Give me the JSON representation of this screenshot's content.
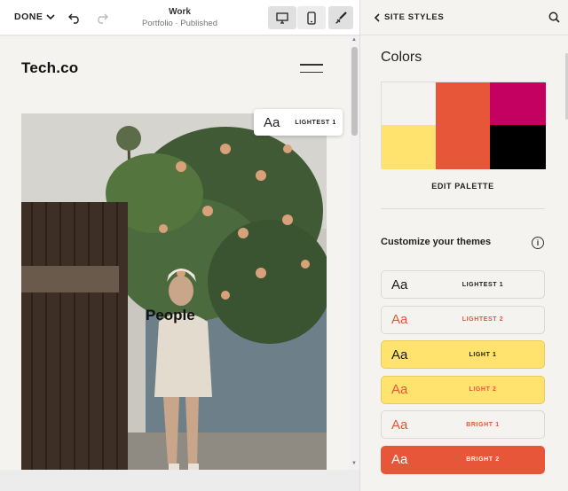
{
  "topbar": {
    "done_label": "DONE",
    "page_title": "Work",
    "page_subtitle": "Portfolio · Published"
  },
  "preview": {
    "logo": "Tech.co",
    "hero_text": "People",
    "theme_tag": {
      "aa": "Aa",
      "label": "LIGHTEST 1"
    }
  },
  "panel": {
    "back_label": "SITE STYLES",
    "colors_heading": "Colors",
    "palette": [
      "#f4f3ef",
      "#e8563a",
      "#c40060",
      "#ffe36e",
      "#e8563a",
      "#000000"
    ],
    "edit_palette_label": "EDIT PALETTE",
    "customize_label": "Customize your themes",
    "info_glyph": "i",
    "themes": [
      {
        "aa": "Aa",
        "label": "LIGHTEST 1",
        "bg": "#f4f3ef",
        "fg": "#1a1a1a",
        "border": "#d8d8d8"
      },
      {
        "aa": "Aa",
        "label": "LIGHTEST 2",
        "bg": "#f4f3ef",
        "fg": "#e8563a",
        "border": "#d8d8d8"
      },
      {
        "aa": "Aa",
        "label": "LIGHT 1",
        "bg": "#ffe36e",
        "fg": "#1a1a1a",
        "border": "#e6cb5f"
      },
      {
        "aa": "Aa",
        "label": "LIGHT 2",
        "bg": "#ffe36e",
        "fg": "#e8563a",
        "border": "#e6cb5f"
      },
      {
        "aa": "Aa",
        "label": "BRIGHT 1",
        "bg": "#f4f3ef",
        "fg": "#e8563a",
        "border": "#d8d8d8"
      },
      {
        "aa": "Aa",
        "label": "BRIGHT 2",
        "bg": "#e8563a",
        "fg": "#ffffff",
        "border": "#e8563a"
      }
    ]
  }
}
